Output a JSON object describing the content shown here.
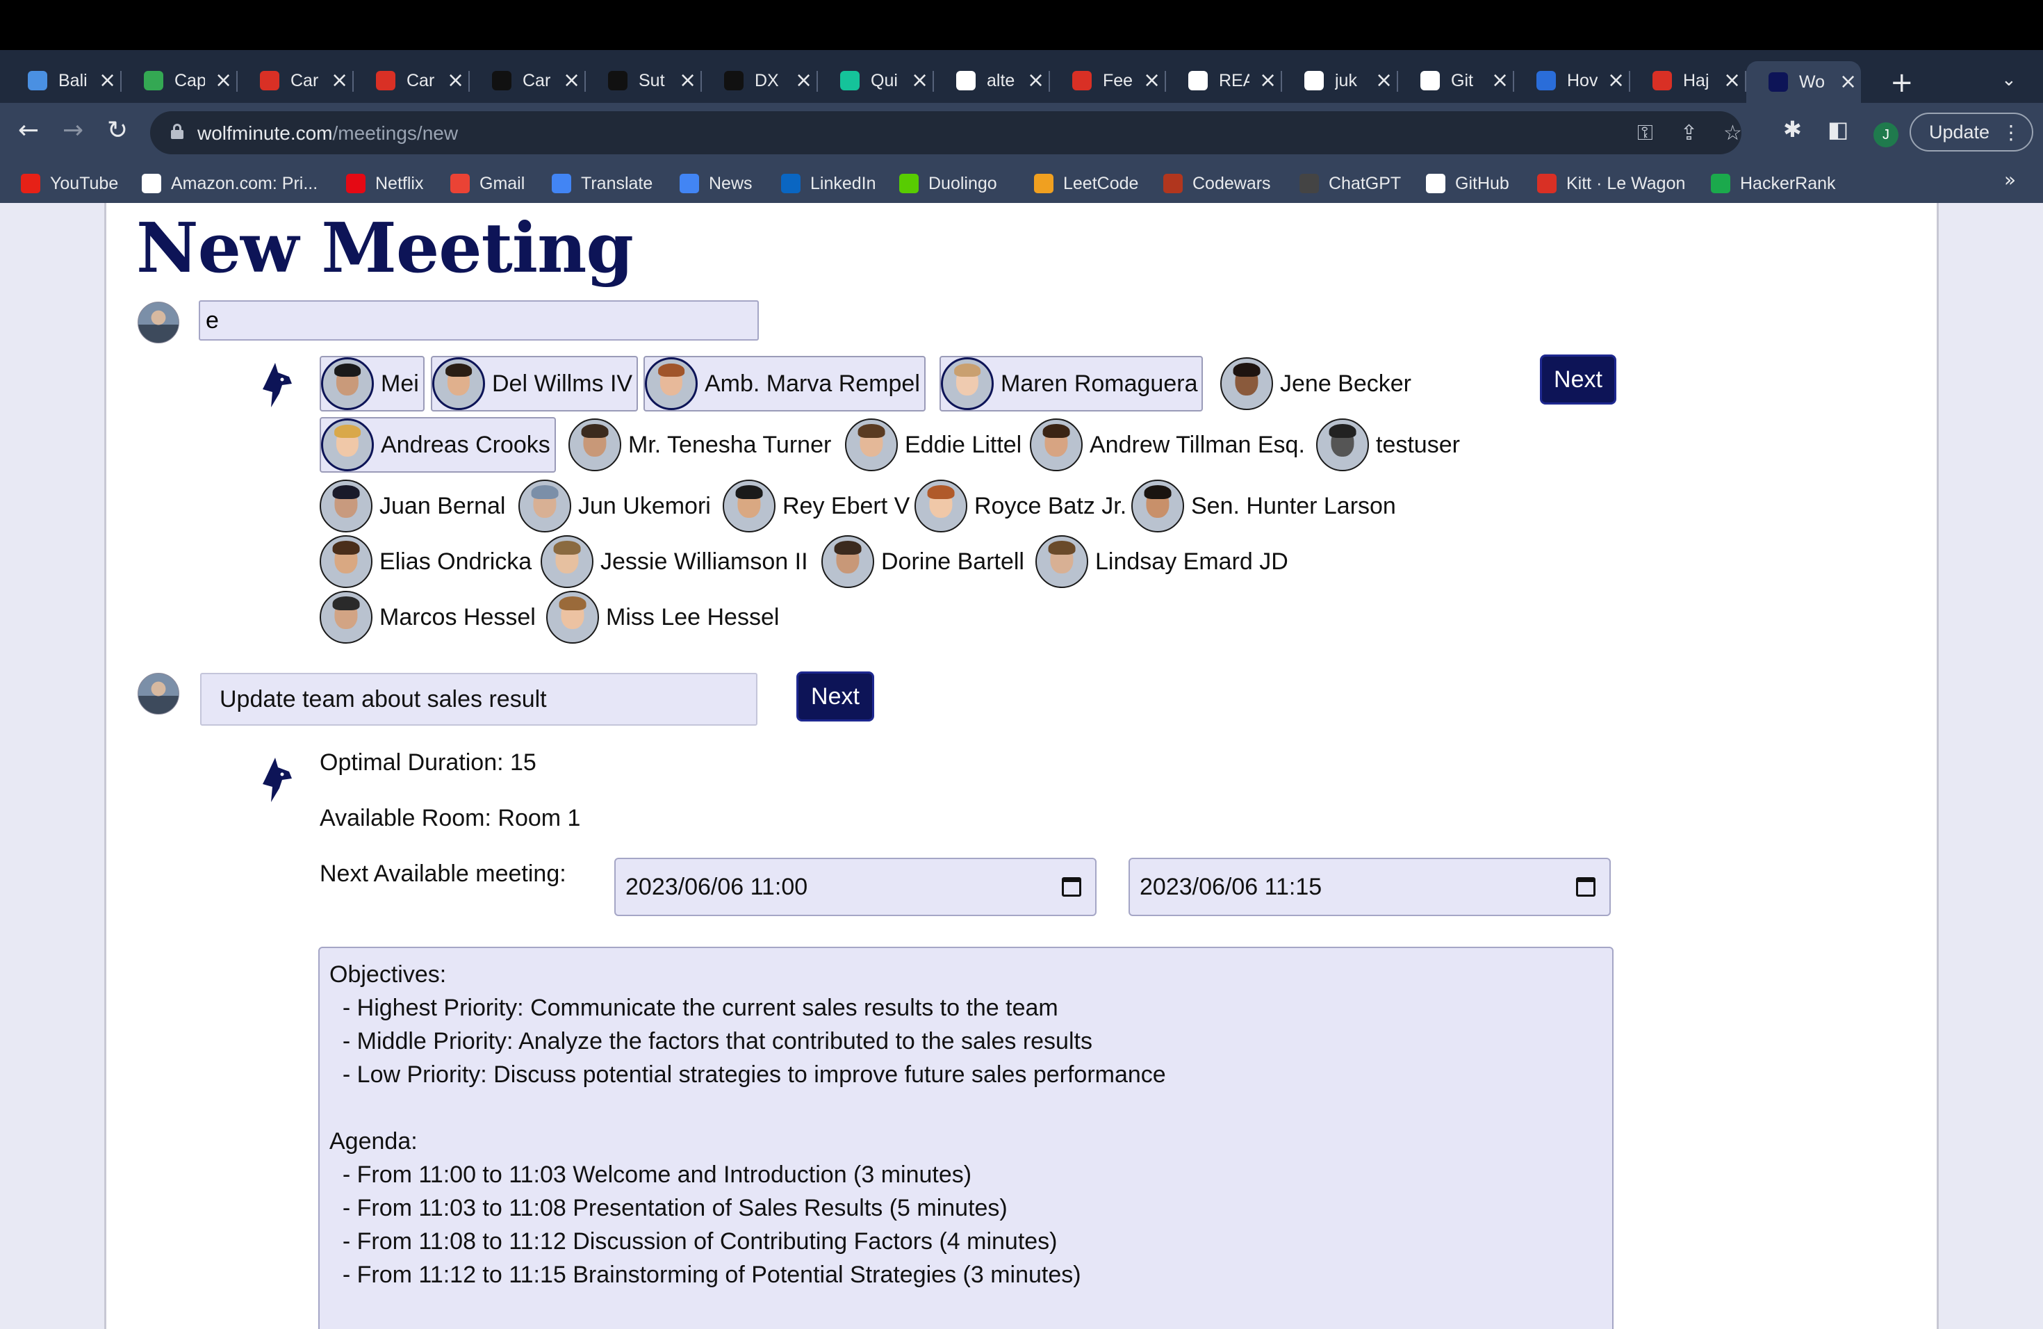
{
  "browser": {
    "tabs": [
      {
        "label": "Bali",
        "icon": "travel-icon",
        "color": "#4a90e2"
      },
      {
        "label": "Cap",
        "icon": "maps-pin-icon",
        "color": "#34a853"
      },
      {
        "label": "Car",
        "icon": "lewagon-icon",
        "color": "#d93025"
      },
      {
        "label": "Car",
        "icon": "lewagon-icon",
        "color": "#d93025"
      },
      {
        "label": "Car",
        "icon": "notion-icon",
        "color": "#111111"
      },
      {
        "label": "Sut",
        "icon": "sutd-icon",
        "color": "#111111"
      },
      {
        "label": "DX",
        "icon": "dx-icon",
        "color": "#111111"
      },
      {
        "label": "Qui",
        "icon": "grammarly-icon",
        "color": "#15c39a"
      },
      {
        "label": "alte",
        "icon": "google-icon",
        "color": "#ffffff"
      },
      {
        "label": "Fee",
        "icon": "lewagon-icon",
        "color": "#d93025"
      },
      {
        "label": "REA",
        "icon": "github-icon",
        "color": "#ffffff"
      },
      {
        "label": "juk",
        "icon": "github-icon",
        "color": "#ffffff"
      },
      {
        "label": "Git",
        "icon": "github-icon",
        "color": "#ffffff"
      },
      {
        "label": "Hov",
        "icon": "medium-icon",
        "color": "#2a6dd9"
      },
      {
        "label": "Haj",
        "icon": "heart-icon",
        "color": "#d93025"
      },
      {
        "label": "Wo",
        "icon": "wolf-icon",
        "color": "#0d1457"
      }
    ],
    "url_host": "wolfminute.com",
    "url_path": "/meetings/new",
    "profile_initial": "J",
    "update_label": "Update",
    "bookmarks": [
      {
        "label": "YouTube",
        "icon": "youtube-icon",
        "color": "#e62117"
      },
      {
        "label": "Amazon.com: Pri...",
        "icon": "amazon-icon",
        "color": "#ffffff"
      },
      {
        "label": "Netflix",
        "icon": "netflix-icon",
        "color": "#e50914"
      },
      {
        "label": "Gmail",
        "icon": "gmail-icon",
        "color": "#ea4335"
      },
      {
        "label": "Translate",
        "icon": "translate-icon",
        "color": "#4285f4"
      },
      {
        "label": "News",
        "icon": "news-icon",
        "color": "#4285f4"
      },
      {
        "label": "LinkedIn",
        "icon": "linkedin-icon",
        "color": "#0a66c2"
      },
      {
        "label": "Duolingo",
        "icon": "duolingo-icon",
        "color": "#58cc02"
      },
      {
        "label": "LeetCode",
        "icon": "leetcode-icon",
        "color": "#f0a020"
      },
      {
        "label": "Codewars",
        "icon": "codewars-icon",
        "color": "#b1361e"
      },
      {
        "label": "ChatGPT",
        "icon": "chatgpt-icon",
        "color": "#444444"
      },
      {
        "label": "GitHub",
        "icon": "github-icon",
        "color": "#ffffff"
      },
      {
        "label": "Kitt · Le Wagon",
        "icon": "lewagon-icon",
        "color": "#d93025"
      },
      {
        "label": "HackerRank",
        "icon": "hackerrank-icon",
        "color": "#1ba94c"
      }
    ]
  },
  "page": {
    "title": "New Meeting",
    "search_value": "e",
    "attendees": [
      {
        "name": "Mei",
        "selected": true,
        "skin": "#c99a7a",
        "hair": "#1a1a1a"
      },
      {
        "name": "Del Willms IV",
        "selected": true,
        "skin": "#e0b08d",
        "hair": "#2a1e14"
      },
      {
        "name": "Amb. Marva Rempel",
        "selected": true,
        "skin": "#e7b99a",
        "hair": "#a0552b"
      },
      {
        "name": "Maren Romaguera",
        "selected": true,
        "skin": "#efcbb0",
        "hair": "#c9a070"
      },
      {
        "name": "Jene Becker",
        "selected": false,
        "skin": "#8a5a3c",
        "hair": "#1e1410"
      },
      {
        "name": "Andreas Crooks",
        "selected": true,
        "skin": "#f0c8a8",
        "hair": "#d9a84a"
      },
      {
        "name": "Mr. Tenesha Turner",
        "selected": false,
        "skin": "#c89878",
        "hair": "#3b2a1e"
      },
      {
        "name": "Eddie Littel",
        "selected": false,
        "skin": "#e4b898",
        "hair": "#5a3b22"
      },
      {
        "name": "Andrew Tillman Esq.",
        "selected": false,
        "skin": "#d7a482",
        "hair": "#3b2414"
      },
      {
        "name": "testuser",
        "selected": false,
        "skin": "#555555",
        "hair": "#222222"
      },
      {
        "name": "Juan Bernal",
        "selected": false,
        "skin": "#c89a7e",
        "hair": "#1a1a2a"
      },
      {
        "name": "Jun Ukemori",
        "selected": false,
        "skin": "#d8b094",
        "hair": "#7b8fa8"
      },
      {
        "name": "Rey Ebert V",
        "selected": false,
        "skin": "#d9a882",
        "hair": "#1a1a1a"
      },
      {
        "name": "Royce Batz Jr.",
        "selected": false,
        "skin": "#f0c8a8",
        "hair": "#b05a2a"
      },
      {
        "name": "Sen. Hunter Larson",
        "selected": false,
        "skin": "#c8906a",
        "hair": "#1a1410"
      },
      {
        "name": "Elias Ondricka",
        "selected": false,
        "skin": "#d9a882",
        "hair": "#4a2e1a"
      },
      {
        "name": "Jessie Williamson II",
        "selected": false,
        "skin": "#e6c0a0",
        "hair": "#8a6a40"
      },
      {
        "name": "Dorine Bartell",
        "selected": false,
        "skin": "#c89878",
        "hair": "#3b2a1e"
      },
      {
        "name": "Lindsay Emard JD",
        "selected": false,
        "skin": "#d8b094",
        "hair": "#6a4a2a"
      },
      {
        "name": "Marcos Hessel",
        "selected": false,
        "skin": "#d2a484",
        "hair": "#2a2a2a"
      },
      {
        "name": "Miss Lee Hessel",
        "selected": false,
        "skin": "#ecc2a2",
        "hair": "#9a6a3a"
      }
    ],
    "next_label": "Next",
    "topic_value": "Update team about sales result",
    "optimal_duration": "Optimal Duration: 15",
    "available_room": "Available Room: Room 1",
    "next_available_label": "Next Available meeting:",
    "start_datetime": "2023/06/06 11:00",
    "end_datetime": "2023/06/06 11:15",
    "notes": "Objectives:\n  - Highest Priority: Communicate the current sales results to the team\n  - Middle Priority: Analyze the factors that contributed to the sales results\n  - Low Priority: Discuss potential strategies to improve future sales performance\n\nAgenda:\n  - From 11:00 to 11:03 Welcome and Introduction (3 minutes)\n  - From 11:03 to 11:08 Presentation of Sales Results (5 minutes)\n  - From 11:08 to 11:12 Discussion of Contributing Factors (4 minutes)\n  - From 11:12 to 11:15 Brainstorming of Potential Strategies (3 minutes)"
  }
}
